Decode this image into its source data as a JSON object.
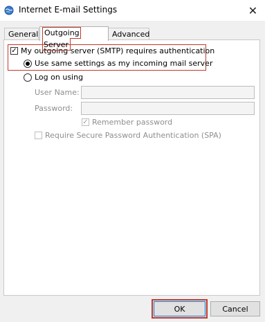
{
  "window": {
    "title": "Internet E-mail Settings",
    "close_glyph": "✕",
    "icon": "globe-icon"
  },
  "tabs": [
    {
      "label": "General",
      "active": false
    },
    {
      "label": "Outgoing Server",
      "active": true
    },
    {
      "label": "Advanced",
      "active": false
    }
  ],
  "outgoing": {
    "requires_auth_label": "My outgoing server (SMTP) requires authentication",
    "requires_auth_checked": true,
    "use_same_label": "Use same settings as my incoming mail server",
    "use_same_selected": true,
    "log_on_label": "Log on using",
    "log_on_selected": false,
    "username_label": "User Name:",
    "username_value": "",
    "password_label": "Password:",
    "password_value": "",
    "remember_label": "Remember password",
    "remember_checked": true,
    "spa_label": "Require Secure Password Authentication (SPA)",
    "spa_checked": false
  },
  "buttons": {
    "ok": "OK",
    "cancel": "Cancel"
  },
  "colors": {
    "highlight": "#c0392b",
    "focus": "#0078d7"
  }
}
